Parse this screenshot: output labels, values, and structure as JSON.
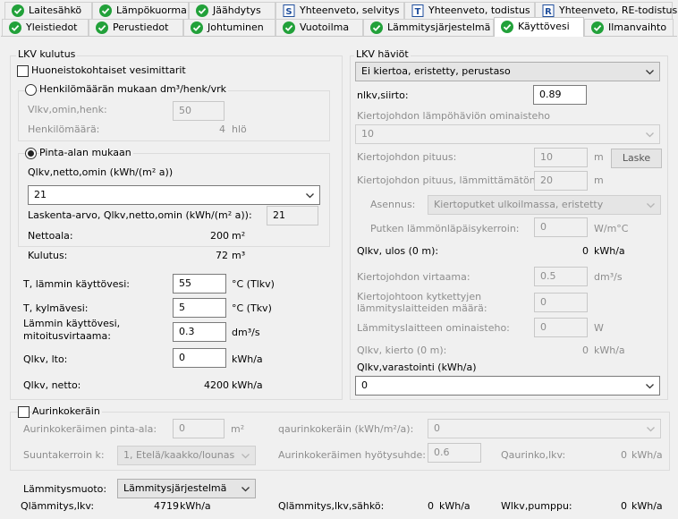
{
  "tabs_row1": [
    {
      "label": "Laitesähkö",
      "icon": "check-icon"
    },
    {
      "label": "Lämpökuorma",
      "icon": "check-icon"
    },
    {
      "label": "Jäähdytys",
      "icon": "check-icon"
    },
    {
      "label": "Yhteenveto, selvitys",
      "icon": "document-s-icon",
      "glyph": "S"
    },
    {
      "label": "Yhteenveto, todistus",
      "icon": "document-t-icon",
      "glyph": "T"
    },
    {
      "label": "Yhteenveto, RE-todistus",
      "icon": "document-r-icon",
      "glyph": "R"
    }
  ],
  "tabs_row2": [
    {
      "label": "Yleistiedot",
      "icon": "check-icon"
    },
    {
      "label": "Perustiedot",
      "icon": "check-icon"
    },
    {
      "label": "Johtuminen",
      "icon": "check-icon"
    },
    {
      "label": "Vuotoilma",
      "icon": "check-icon"
    },
    {
      "label": "Lämmitysjärjestelmä",
      "icon": "check-icon"
    },
    {
      "label": "Käyttövesi",
      "icon": "check-icon"
    },
    {
      "label": "Ilmanvaihto",
      "icon": "check-icon"
    }
  ],
  "colors": {
    "check_green": "#22a13a",
    "doc_blue": "#1f4e9c"
  },
  "lkv_kulutus": {
    "title": "LKV kulutus",
    "vesimittarit_label": "Huoneistokohtaiset vesimittarit",
    "hlo": {
      "radio_label": "Henkilömäärän mukaan dm³/henk/vrk",
      "vlkv_label": "Vlkv,omin,henk:",
      "vlkv_value": "50",
      "count_label": "Henkilömäärä:",
      "count_value": "4",
      "count_unit": "hlö"
    },
    "pinta": {
      "radio_label": "Pinta-alan mukaan",
      "qlkv_label": "Qlkv,netto,omin (kWh/(m² a))",
      "qlkv_select": "21",
      "laskenta_label": "Laskenta-arvo, Qlkv,netto,omin (kWh/(m² a)):",
      "laskenta_value": "21",
      "nettoala_label": "Nettoala:",
      "nettoala_value": "200",
      "nettoala_unit": "m²"
    },
    "kulutus_label": "Kulutus:",
    "kulutus_value": "72",
    "kulutus_unit": "m³",
    "t_lammin_label": "T, lämmin käyttövesi:",
    "t_lammin_value": "55",
    "t_lammin_unit": "°C (Tlkv)",
    "t_kylma_label": "T, kylmävesi:",
    "t_kylma_value": "5",
    "t_kylma_unit": "°C (Tkv)",
    "virtaama_label_1": "Lämmin käyttövesi,",
    "virtaama_label_2": "mitoitusvirtaama:",
    "virtaama_value": "0.3",
    "virtaama_unit": "dm³/s",
    "qlkv_lto_label": "Qlkv, lto:",
    "qlkv_lto_value": "0",
    "qlkv_lto_unit": "kWh/a",
    "qlkv_netto_label": "Qlkv, netto:",
    "qlkv_netto_value": "4200",
    "qlkv_netto_unit": "kWh/a"
  },
  "lkv_haviot": {
    "title": "LKV häviöt",
    "type_select": "Ei kiertoa, eristetty, perustaso",
    "nlkv_label": "nlkv,siirto:",
    "nlkv_value": "0.89",
    "omin_label": "Kiertojohdon lämpöhäviön ominaisteho",
    "omin_select": "10",
    "pituus_label": "Kiertojohdon pituus:",
    "pituus_value": "10",
    "pituus_unit": "m",
    "laske_label": "Laske",
    "pituus_lamm_label": "Kiertojohdon pituus, lämmittämätön:",
    "pituus_lamm_value": "20",
    "pituus_lamm_unit": "m",
    "asennus_label": "Asennus:",
    "asennus_select": "Kiertoputket ulkoilmassa, eristetty",
    "putken_label": "Putken lämmönläpäisykerroin:",
    "putken_value": "0",
    "putken_unit": "W/m°C",
    "qlkv_ulos_label": "Qlkv, ulos (0 m):",
    "qlkv_ulos_value": "0",
    "qlkv_ulos_unit": "kWh/a",
    "virtaama_label": "Kiertojohdon virtaama:",
    "virtaama_value": "0.5",
    "virtaama_unit": "dm³/s",
    "laitteiden_label_1": "Kiertojohtoon kytkettyjen",
    "laitteiden_label_2": "lämmityslaitteiden määrä:",
    "laitteiden_value": "0",
    "laite_omin_label": "Lämmityslaitteen ominaisteho:",
    "laite_omin_value": "0",
    "laite_omin_unit": "W",
    "kierto_label": "Qlkv, kierto (0 m):",
    "kierto_value": "0",
    "kierto_unit": "kWh/a",
    "varastointi_label": "Qlkv,varastointi (kWh/a)",
    "varastointi_select": "0"
  },
  "aurinko": {
    "checkbox_label": "Aurinkokeräin",
    "pinta_label": "Aurinkokeräimen pinta-ala:",
    "pinta_value": "0",
    "pinta_unit": "m²",
    "qaurinko_label": "qaurinkokeräin (kWh/m²/a):",
    "qaurinko_select": "0",
    "suunta_label": "Suuntakerroin k:",
    "suunta_select": "1, Etelä/kaakko/lounas",
    "hyoty_label": "Aurinkokeräimen hyötysuhde:",
    "hyoty_value": "0.6",
    "qaurinko_lkv_label": "Qaurinko,lkv:",
    "qaurinko_lkv_value": "0",
    "qaurinko_lkv_unit": "kWh/a"
  },
  "bottom": {
    "lammitysmuoto_label": "Lämmitysmuoto:",
    "lammitysmuoto_select": "Lämmitysjärjestelmä",
    "qlamm_label": "Qlämmitys,lkv:",
    "qlamm_value": "4719",
    "qlamm_unit": "kWh/a",
    "qlamm_sahko_label": "Qlämmitys,lkv,sähkö:",
    "qlamm_sahko_value": "0",
    "qlamm_sahko_unit": "kWh/a",
    "wlkv_label": "Wlkv,pumppu:",
    "wlkv_value": "0",
    "wlkv_unit": "kWh/a"
  }
}
